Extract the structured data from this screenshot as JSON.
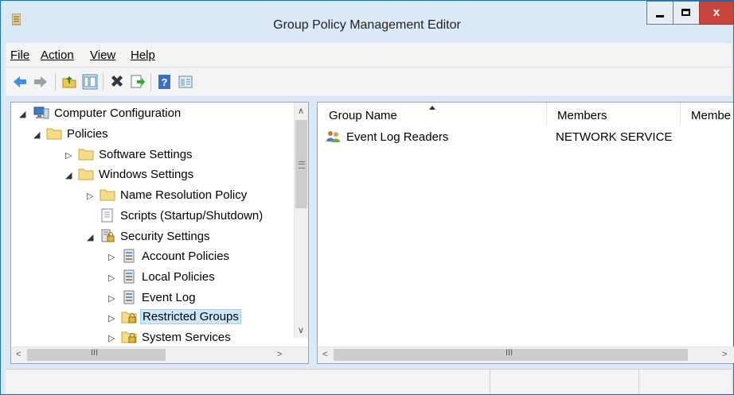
{
  "window": {
    "title": "Group Policy Management Editor",
    "close_glyph": "x"
  },
  "menu": [
    {
      "label": "File"
    },
    {
      "label": "Action"
    },
    {
      "label": "View"
    },
    {
      "label": "Help"
    }
  ],
  "toolbar": [
    "back-arrow-icon",
    "forward-arrow-icon",
    "up-folder-icon",
    "show-hide-tree-icon",
    "delete-icon",
    "export-list-icon",
    "help-icon",
    "properties-pane-icon"
  ],
  "tree": [
    {
      "label": "Computer Configuration",
      "icon": "computer-icon"
    },
    {
      "label": "Policies",
      "icon": "folder-icon"
    },
    {
      "label": "Software Settings",
      "icon": "folder-icon"
    },
    {
      "label": "Windows Settings",
      "icon": "folder-icon"
    },
    {
      "label": "Name Resolution Policy",
      "icon": "folder-icon"
    },
    {
      "label": "Scripts (Startup/Shutdown)",
      "icon": "script-icon"
    },
    {
      "label": "Security Settings",
      "icon": "security-settings-icon"
    },
    {
      "label": "Account Policies",
      "icon": "policy-icon"
    },
    {
      "label": "Local Policies",
      "icon": "policy-icon"
    },
    {
      "label": "Event Log",
      "icon": "policy-icon"
    },
    {
      "label": "Restricted Groups",
      "icon": "secure-folder-icon"
    },
    {
      "label": "System Services",
      "icon": "secure-folder-icon"
    }
  ],
  "list": {
    "columns": [
      {
        "label": "Group Name"
      },
      {
        "label": "Members"
      },
      {
        "label": "Membe"
      }
    ],
    "rows": [
      {
        "group": "Event Log Readers",
        "members": "NETWORK SERVICE",
        "icon": "group-icon"
      }
    ]
  },
  "scrollbar_grip": "III",
  "colors": {
    "accent": "#1b6fb5",
    "selection": "#cce8ff",
    "close": "#c7453d"
  }
}
